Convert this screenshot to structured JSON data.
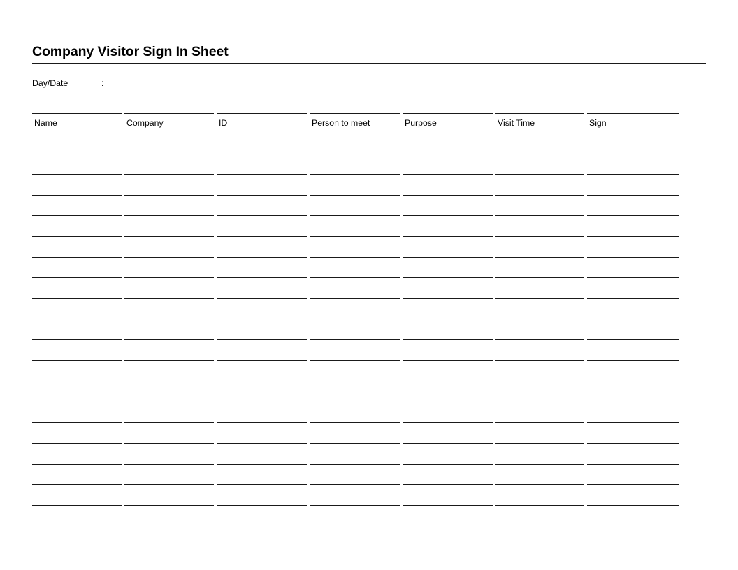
{
  "document": {
    "title": "Company Visitor Sign In Sheet",
    "page_background": "#ffffff",
    "rule_color": "#1a1a1a"
  },
  "meta_fields": [
    {
      "label": "Day/Date",
      "separator": ":",
      "value": ""
    }
  ],
  "table": {
    "columns": [
      {
        "key": "name",
        "label": "Name"
      },
      {
        "key": "company",
        "label": "Company"
      },
      {
        "key": "id",
        "label": "ID"
      },
      {
        "key": "person_to_meet",
        "label": "Person to meet"
      },
      {
        "key": "purpose",
        "label": "Purpose"
      },
      {
        "key": "visit_time",
        "label": "Visit Time"
      },
      {
        "key": "sign",
        "label": "Sign"
      }
    ],
    "row_count": 18,
    "rows": [
      {
        "name": "",
        "company": "",
        "id": "",
        "person_to_meet": "",
        "purpose": "",
        "visit_time": "",
        "sign": ""
      },
      {
        "name": "",
        "company": "",
        "id": "",
        "person_to_meet": "",
        "purpose": "",
        "visit_time": "",
        "sign": ""
      },
      {
        "name": "",
        "company": "",
        "id": "",
        "person_to_meet": "",
        "purpose": "",
        "visit_time": "",
        "sign": ""
      },
      {
        "name": "",
        "company": "",
        "id": "",
        "person_to_meet": "",
        "purpose": "",
        "visit_time": "",
        "sign": ""
      },
      {
        "name": "",
        "company": "",
        "id": "",
        "person_to_meet": "",
        "purpose": "",
        "visit_time": "",
        "sign": ""
      },
      {
        "name": "",
        "company": "",
        "id": "",
        "person_to_meet": "",
        "purpose": "",
        "visit_time": "",
        "sign": ""
      },
      {
        "name": "",
        "company": "",
        "id": "",
        "person_to_meet": "",
        "purpose": "",
        "visit_time": "",
        "sign": ""
      },
      {
        "name": "",
        "company": "",
        "id": "",
        "person_to_meet": "",
        "purpose": "",
        "visit_time": "",
        "sign": ""
      },
      {
        "name": "",
        "company": "",
        "id": "",
        "person_to_meet": "",
        "purpose": "",
        "visit_time": "",
        "sign": ""
      },
      {
        "name": "",
        "company": "",
        "id": "",
        "person_to_meet": "",
        "purpose": "",
        "visit_time": "",
        "sign": ""
      },
      {
        "name": "",
        "company": "",
        "id": "",
        "person_to_meet": "",
        "purpose": "",
        "visit_time": "",
        "sign": ""
      },
      {
        "name": "",
        "company": "",
        "id": "",
        "person_to_meet": "",
        "purpose": "",
        "visit_time": "",
        "sign": ""
      },
      {
        "name": "",
        "company": "",
        "id": "",
        "person_to_meet": "",
        "purpose": "",
        "visit_time": "",
        "sign": ""
      },
      {
        "name": "",
        "company": "",
        "id": "",
        "person_to_meet": "",
        "purpose": "",
        "visit_time": "",
        "sign": ""
      },
      {
        "name": "",
        "company": "",
        "id": "",
        "person_to_meet": "",
        "purpose": "",
        "visit_time": "",
        "sign": ""
      },
      {
        "name": "",
        "company": "",
        "id": "",
        "person_to_meet": "",
        "purpose": "",
        "visit_time": "",
        "sign": ""
      },
      {
        "name": "",
        "company": "",
        "id": "",
        "person_to_meet": "",
        "purpose": "",
        "visit_time": "",
        "sign": ""
      },
      {
        "name": "",
        "company": "",
        "id": "",
        "person_to_meet": "",
        "purpose": "",
        "visit_time": "",
        "sign": ""
      }
    ]
  }
}
